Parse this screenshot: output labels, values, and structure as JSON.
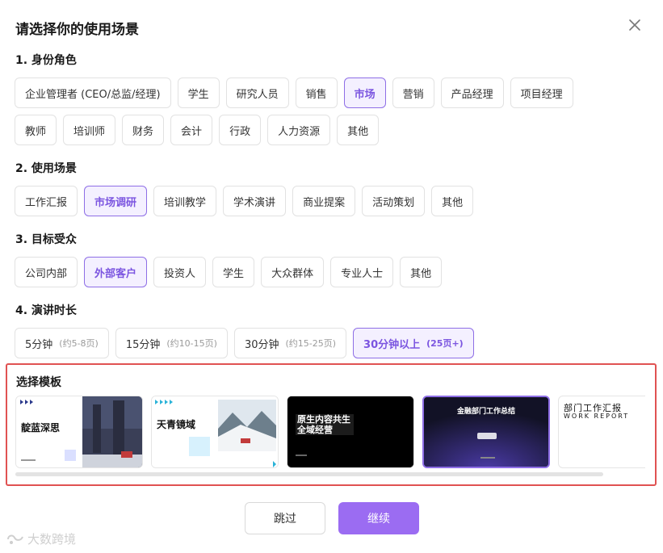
{
  "dialog": {
    "title": "请选择你的使用场景"
  },
  "sections": {
    "role": {
      "label": "1. 身份角色",
      "options": [
        "企业管理者 (CEO/总监/经理)",
        "学生",
        "研究人员",
        "销售",
        "市场",
        "营销",
        "产品经理",
        "项目经理",
        "教师",
        "培训师",
        "财务",
        "会计",
        "行政",
        "人力资源",
        "其他"
      ],
      "selected": "市场"
    },
    "scenario": {
      "label": "2. 使用场景",
      "options": [
        "工作汇报",
        "市场调研",
        "培训教学",
        "学术演讲",
        "商业提案",
        "活动策划",
        "其他"
      ],
      "selected": "市场调研"
    },
    "audience": {
      "label": "3. 目标受众",
      "options": [
        "公司内部",
        "外部客户",
        "投资人",
        "学生",
        "大众群体",
        "专业人士",
        "其他"
      ],
      "selected": "外部客户"
    },
    "duration": {
      "label": "4. 演讲时长",
      "options": [
        {
          "main": "5分钟",
          "sub": "(约5-8页)"
        },
        {
          "main": "15分钟",
          "sub": "(约10-15页)"
        },
        {
          "main": "30分钟",
          "sub": "(约15-25页)"
        },
        {
          "main": "30分钟以上",
          "sub": "(25页+)"
        }
      ],
      "selected": "30分钟以上"
    }
  },
  "templates": {
    "label": "选择模板",
    "items": [
      {
        "title": "靛蓝深思"
      },
      {
        "title": "天青镜域"
      },
      {
        "title": "原生内容共生 全域经营"
      },
      {
        "title": "金融部门工作总结"
      },
      {
        "title": "部门工作汇报",
        "subtitle": "WORK REPORT"
      }
    ],
    "selected_index": 3
  },
  "actions": {
    "skip": "跳过",
    "continue": "继续"
  },
  "watermark": "大数跨境",
  "colors": {
    "accent": "#8e6ee6",
    "primary_button": "#9b6cf2",
    "highlight_border": "#e05252"
  }
}
